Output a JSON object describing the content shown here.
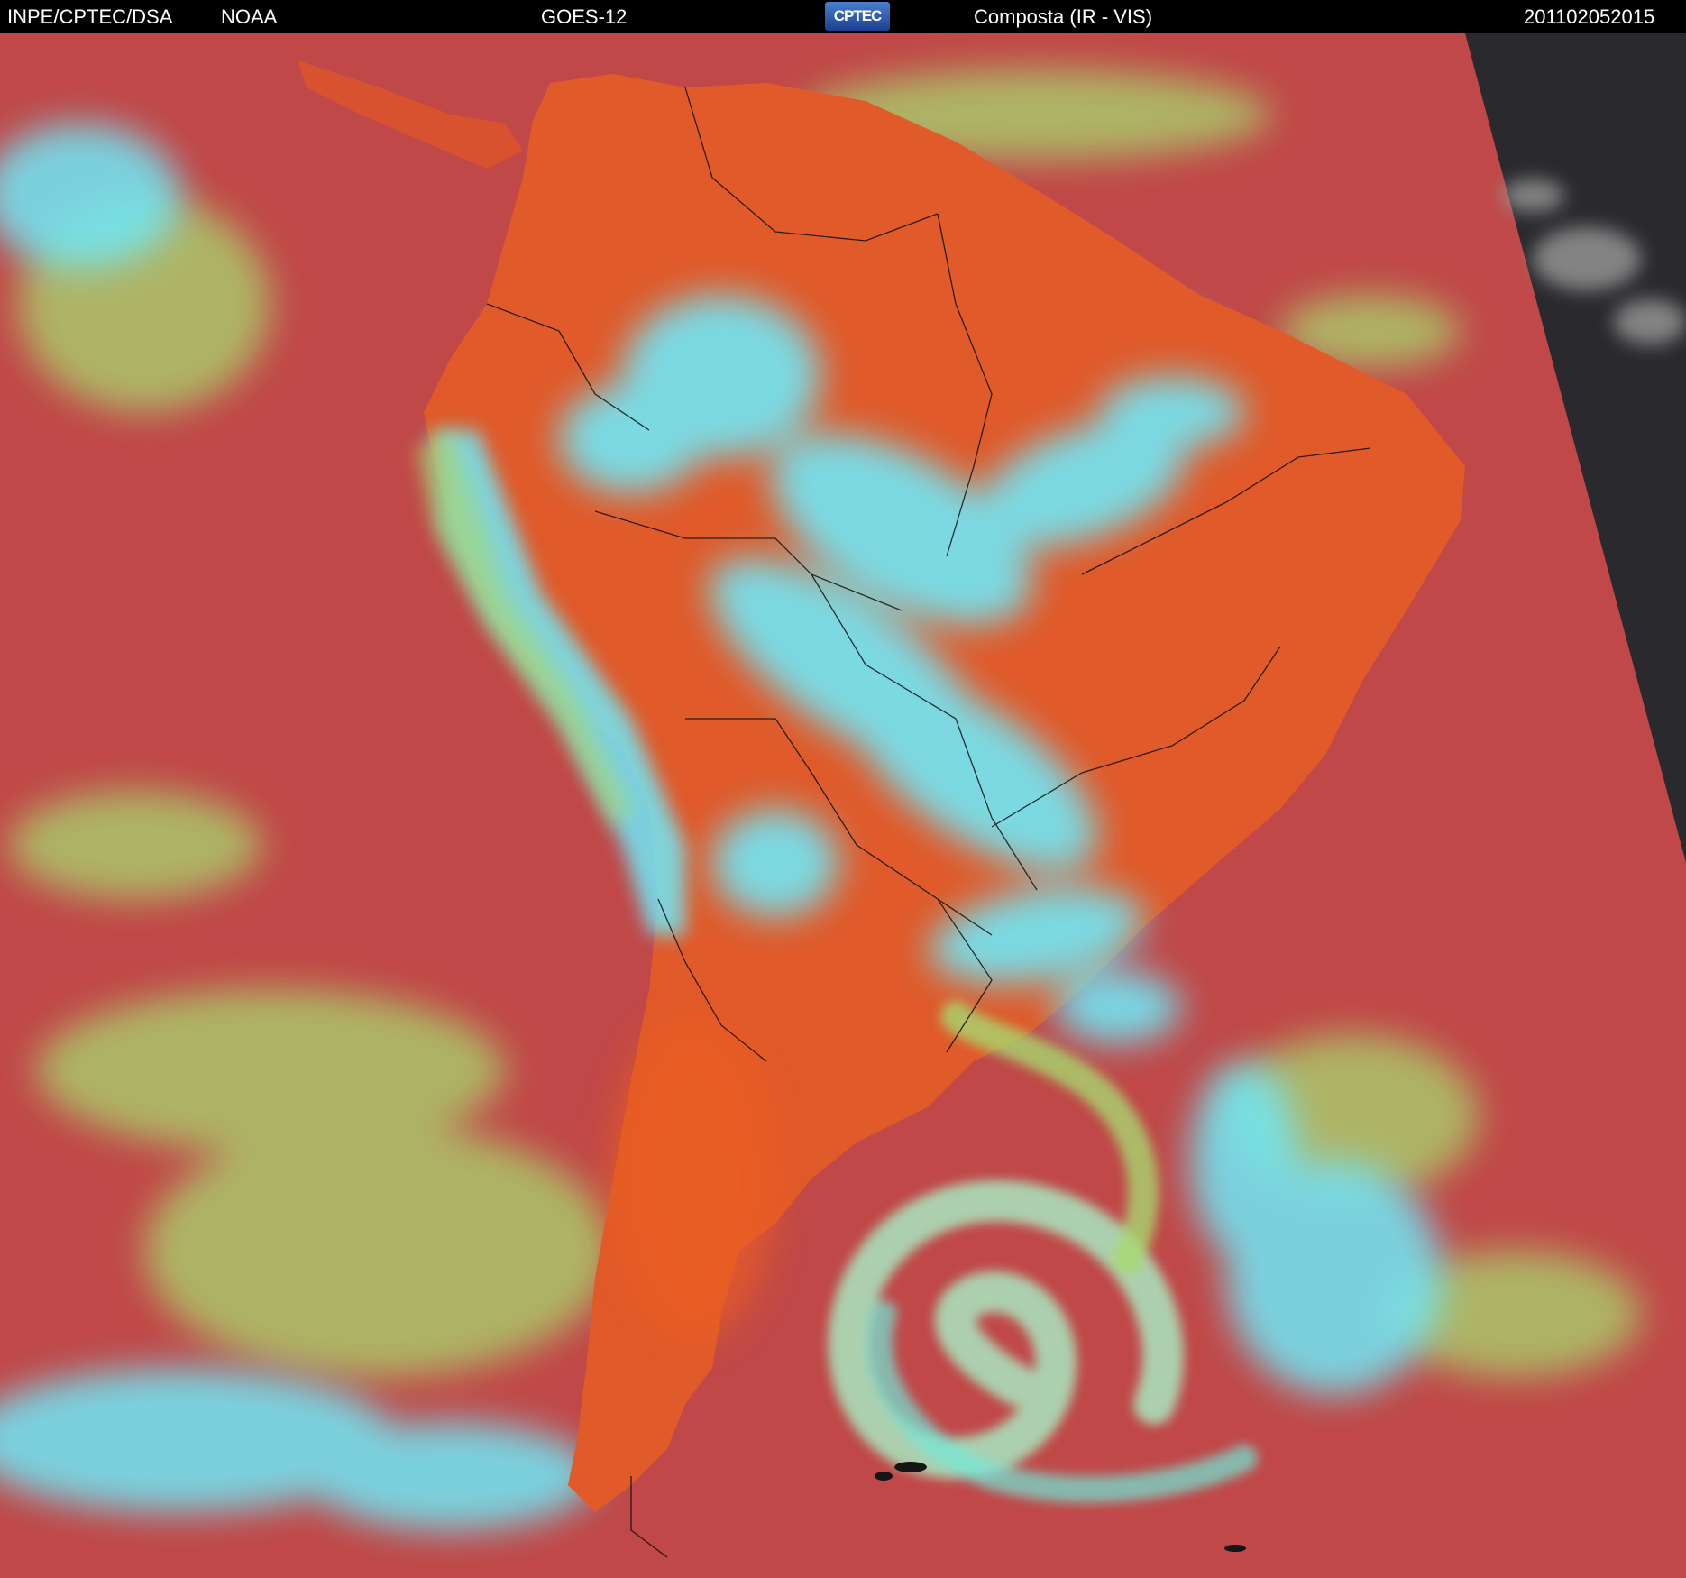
{
  "header": {
    "source": "INPE/CPTEC/DSA",
    "agency": "NOAA",
    "satellite": "GOES-12",
    "logo_text": "CPTEC",
    "product": "Composta (IR - VIS)",
    "timestamp": "201102052015"
  },
  "colors": {
    "ocean_clear": "#c04848",
    "land_clear": "#e05a2a",
    "high_cloud": "#70e8f8",
    "low_cloud": "#a8d870",
    "night_side": "#2a2a2e",
    "header_bg": "#000000",
    "header_text": "#ffffff",
    "borders": "#101010"
  },
  "icons": {
    "logo": "cptec-logo"
  }
}
